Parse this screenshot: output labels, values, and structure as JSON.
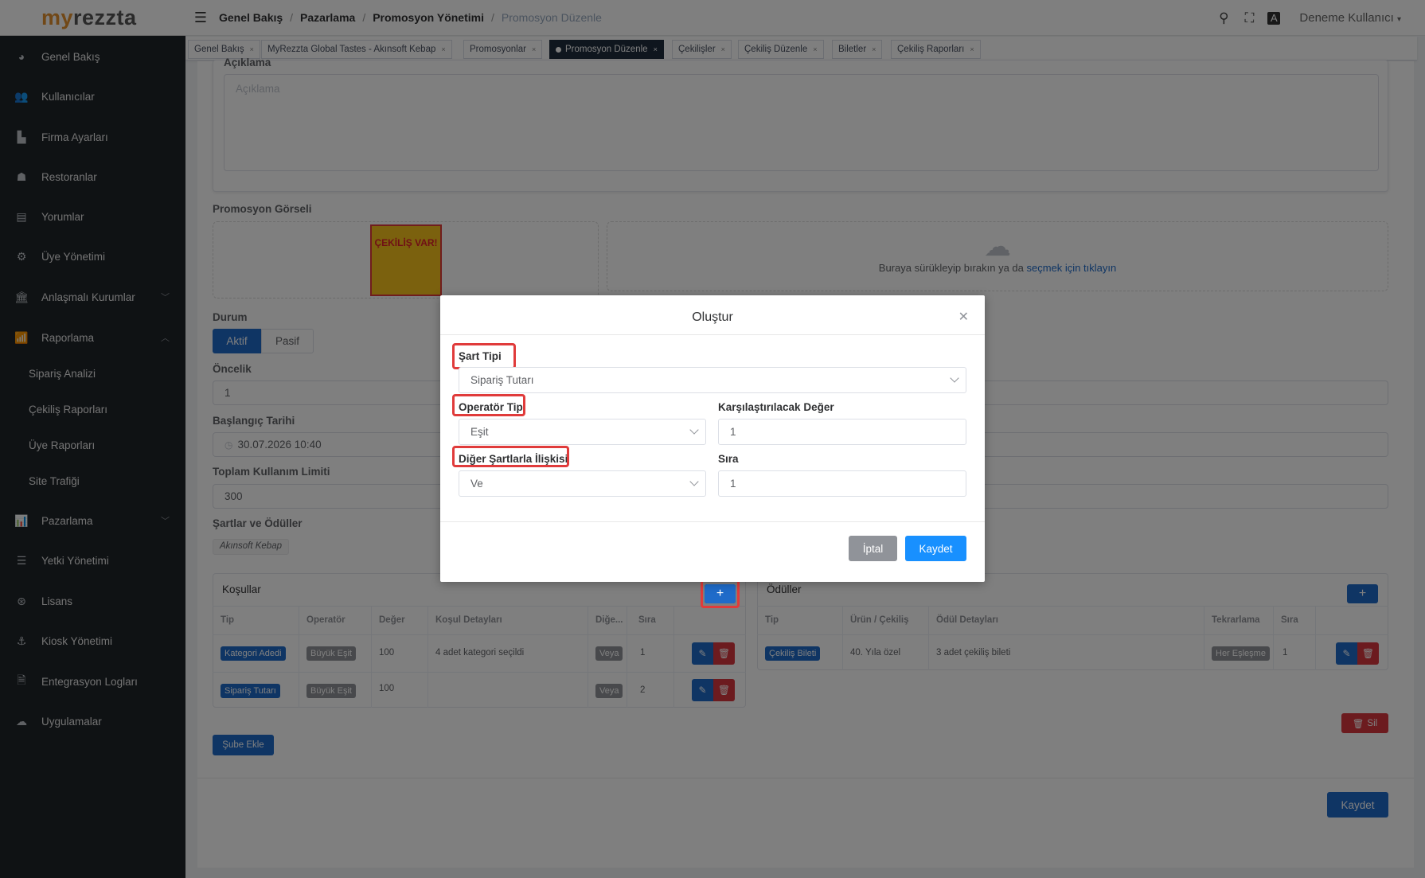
{
  "brand": {
    "part1": "my",
    "part2": "rezzta"
  },
  "sidebar": {
    "items": [
      {
        "label": "Genel Bakış",
        "icon": "dashboard-icon",
        "glyph": "◕"
      },
      {
        "label": "Kullanıcılar",
        "icon": "users-icon",
        "glyph": "👥"
      },
      {
        "label": "Firma Ayarları",
        "icon": "building-icon",
        "glyph": "▙"
      },
      {
        "label": "Restoranlar",
        "icon": "sitemap-icon",
        "glyph": "☗"
      },
      {
        "label": "Yorumlar",
        "icon": "document-icon",
        "glyph": "▤"
      },
      {
        "label": "Üye Yönetimi",
        "icon": "gear-users-icon",
        "glyph": "⚙"
      },
      {
        "label": "Anlaşmalı Kurumlar",
        "icon": "bank-icon",
        "glyph": "🏛"
      },
      {
        "label": "Raporlama",
        "icon": "chart-icon",
        "glyph": "📶"
      },
      {
        "label": "Pazarlama",
        "icon": "marketing-icon",
        "glyph": "📊"
      },
      {
        "label": "Yetki Yönetimi",
        "icon": "list-icon",
        "glyph": "☰"
      },
      {
        "label": "Lisans",
        "icon": "license-icon",
        "glyph": "⊛"
      },
      {
        "label": "Kiosk Yönetimi",
        "icon": "kiosk-icon",
        "glyph": "⚓"
      },
      {
        "label": "Entegrasyon Logları",
        "icon": "log-icon",
        "glyph": "🗎"
      },
      {
        "label": "Uygulamalar",
        "icon": "cloud-icon",
        "glyph": "☁"
      }
    ],
    "sub_items": [
      "Sipariş Analizi",
      "Çekiliş Raporları",
      "Üye Raporları",
      "Site Trafiği"
    ]
  },
  "header": {
    "breadcrumb": [
      "Genel Bakış",
      "Pazarlama",
      "Promosyon Yönetimi"
    ],
    "breadcrumb_current": "Promosyon Düzenle",
    "user": "Deneme Kullanıcı"
  },
  "tags": [
    "Genel Bakış",
    "MyRezzta Global Tastes - Akınsoft Kebap",
    "Promosyonlar",
    "Promosyon Düzenle",
    "Çekilişler",
    "Çekiliş Düzenle",
    "Biletler",
    "Çekiliş Raporları"
  ],
  "form": {
    "description_label": "Açıklama",
    "description_placeholder": "Açıklama",
    "image_label": "Promosyon Görseli",
    "image_alt": "ÇEKİLİŞ VAR!",
    "upload_text": "Buraya sürükleyip bırakın ya da",
    "upload_link": "seçmek için tıklayın",
    "status_label": "Durum",
    "status_active": "Aktif",
    "status_passive": "Pasif",
    "priority_label": "Öncelik",
    "priority_value": "1",
    "start_label": "Başlangıç Tarihi",
    "start_value": "30.07.2026 10:40",
    "limit_label": "Toplam Kullanım Limiti",
    "limit_value": "300",
    "rules_label": "Şartlar ve Ödüller",
    "branch_tag": "Akınsoft Kebap"
  },
  "conditions": {
    "title": "Koşullar",
    "headers": [
      "Tip",
      "Operatör",
      "Değer",
      "Koşul Detayları",
      "Diğe...",
      "Sıra"
    ],
    "rows": [
      {
        "type": "Kategori Adedi",
        "operator": "Büyük Eşit",
        "value": "100",
        "details": "4 adet kategori seçildi",
        "relation": "Veya",
        "order": "1"
      },
      {
        "type": "Sipariş Tutarı",
        "operator": "Büyük Eşit",
        "value": "100",
        "details": "",
        "relation": "Veya",
        "order": "2"
      }
    ]
  },
  "rewards": {
    "title": "Ödüller",
    "headers": [
      "Tip",
      "Ürün / Çekiliş",
      "Ödül Detayları",
      "Tekrarlama",
      "Sıra"
    ],
    "rows": [
      {
        "type": "Çekiliş Bileti",
        "item": "40. Yıla özel",
        "details": "3 adet çekiliş bileti",
        "repeat": "Her Eşleşme",
        "order": "1"
      }
    ]
  },
  "buttons": {
    "add_branch": "Şube Ekle",
    "delete": "Sil",
    "save": "Kaydet",
    "add": "+"
  },
  "modal": {
    "title": "Oluştur",
    "condition_type_label": "Şart Tipi",
    "condition_type_value": "Sipariş Tutarı",
    "operator_label": "Operatör Tipi",
    "operator_value": "Eşit",
    "compare_label": "Karşılaştırılacak Değer",
    "compare_value": "1",
    "relation_label": "Diğer Şartlarla İlişkisi",
    "relation_value": "Ve",
    "order_label": "Sıra",
    "order_value": "1",
    "cancel": "İptal",
    "save": "Kaydet"
  }
}
